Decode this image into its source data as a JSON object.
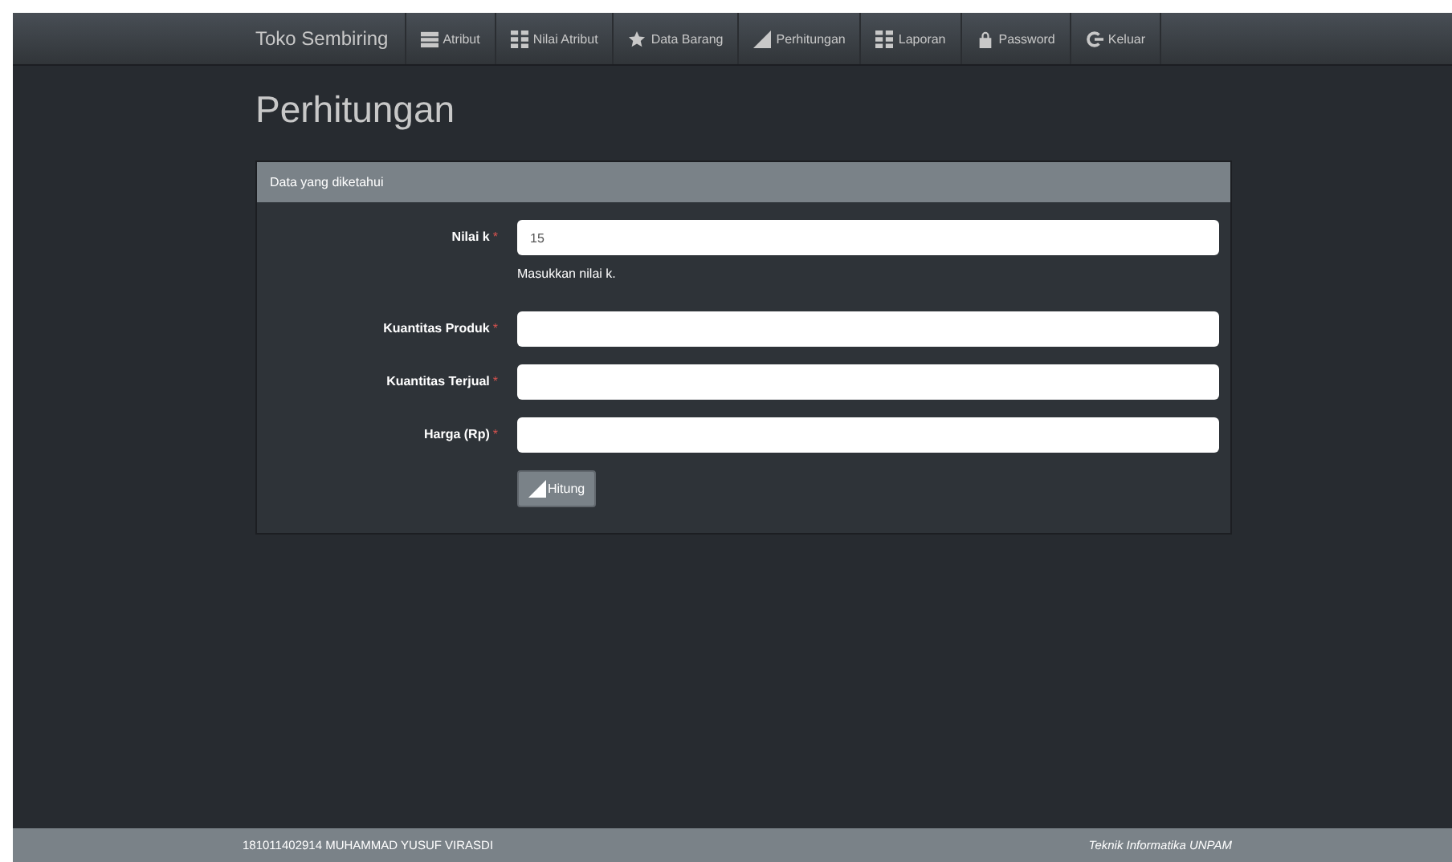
{
  "navbar": {
    "brand": "Toko Sembiring",
    "items": [
      {
        "label": "Atribut",
        "kind": "list"
      },
      {
        "label": "Nilai Atribut",
        "kind": "grid"
      },
      {
        "label": "Data Barang",
        "kind": "star"
      },
      {
        "label": "Perhitungan",
        "kind": "signal"
      },
      {
        "label": "Laporan",
        "kind": "grid"
      },
      {
        "label": "Password",
        "kind": "lock"
      },
      {
        "label": "Keluar",
        "kind": "logout"
      }
    ]
  },
  "page_title": "Perhitungan",
  "panel": {
    "heading": "Data yang diketahui",
    "fields": [
      {
        "label": "Nilai k",
        "required": true,
        "value": "15",
        "help": "Masukkan nilai k."
      },
      {
        "label": "Kuantitas Produk",
        "required": true
      },
      {
        "label": "Kuantitas Terjual",
        "required": true
      },
      {
        "label": "Harga (Rp)",
        "required": true
      }
    ],
    "required_mark": "*",
    "button": {
      "label": "Hitung",
      "kind": "signal"
    }
  },
  "footer": {
    "left": "181011402914 MUHAMMAD YUSUF VIRASDI",
    "right": "Teknik Informatika UNPAM"
  }
}
